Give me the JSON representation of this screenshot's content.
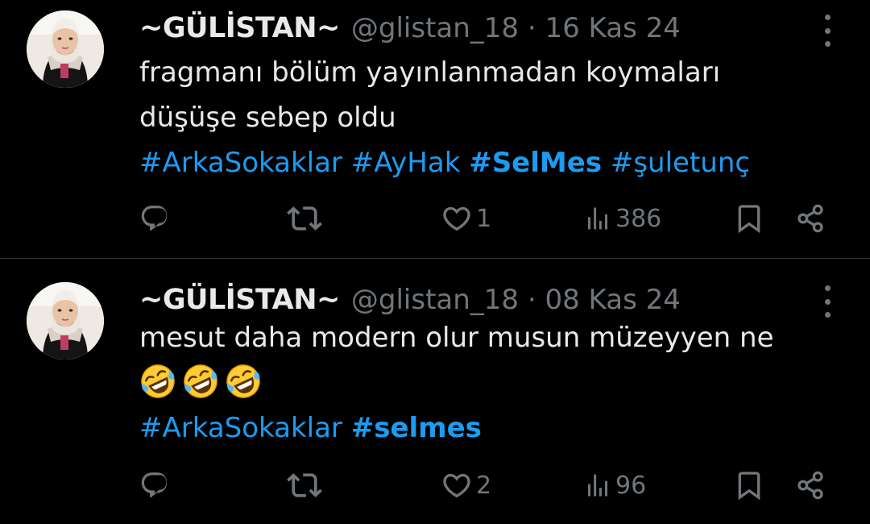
{
  "colors": {
    "background": "#000000",
    "text": "#e7e9ea",
    "muted": "#71767b",
    "link": "#1d9bf0",
    "divider": "#2f3336"
  },
  "tweets": [
    {
      "author": {
        "name": "~GÜLİSTAN~",
        "handle": "@glistan_18"
      },
      "date_line": "@glistan_18 · 16 Kas 24",
      "text_lines": [
        "fragmanı bölüm yayınlanmadan koymaları",
        "düşüşe sebep oldu"
      ],
      "hashtags": [
        "#ArkaSokaklar",
        "#AyHak",
        "#SelMes",
        "#şuletunç"
      ],
      "stats": {
        "likes": "1",
        "views": "386"
      }
    },
    {
      "author": {
        "name": "~GÜLİSTAN~",
        "handle": "@glistan_18"
      },
      "date_line": "@glistan_18 · 08 Kas 24",
      "text_lines": [
        "mesut daha modern olur musun müzeyyen ne"
      ],
      "emoji": [
        "rolling-on-floor-laughing",
        "rolling-on-floor-laughing",
        "rolling-on-floor-laughing"
      ],
      "hashtags": [
        "#ArkaSokaklar",
        "#selmes"
      ],
      "stats": {
        "likes": "2",
        "views": "96"
      }
    }
  ],
  "icons": [
    "more-icon",
    "reply-icon",
    "retweet-icon",
    "like-icon",
    "views-icon",
    "bookmark-icon",
    "share-icon"
  ]
}
